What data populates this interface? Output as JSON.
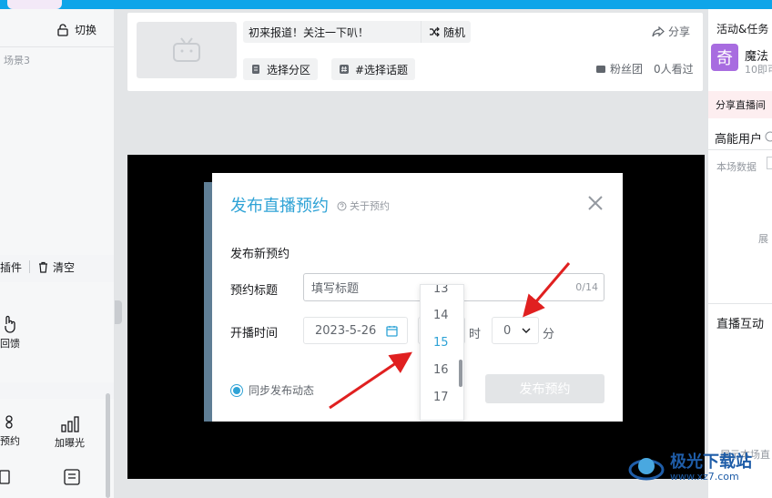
{
  "left_panel": {
    "switch_label": "切换",
    "scene_label": "场景3",
    "plugins_label": "插件",
    "clear_label": "清空",
    "feedback_label": "回馈",
    "reserve_label": "预约",
    "exposure_label": "加曝光"
  },
  "header": {
    "title_value": "初来报道！关注一下叭！",
    "random_label": "随机",
    "share_label": "分享",
    "select_area_label": "选择分区",
    "select_topic_label": "#选择话题",
    "fans_label": "粉丝团",
    "watchers_label": "0人看过"
  },
  "right_panel": {
    "activity_label": "活动&任务",
    "magic_label": "魔法",
    "magic_sub": "10即可",
    "qi_char": "奇",
    "share_live_label": "分享直播间",
    "high_energy_label": "高能用户",
    "this_data_label": "本场数据",
    "expand_label": "展",
    "live_interact_label": "直播互动",
    "show_label": "展示本场直"
  },
  "modal": {
    "title": "发布直播预约",
    "about_label": "关于预约",
    "new_label": "发布新预约",
    "title_field_label": "预约标题",
    "title_placeholder": "填写标题",
    "title_counter": "0/14",
    "time_label": "开播时间",
    "date_value": "2023-5-26",
    "hour_unit": "时",
    "minute_value": "0",
    "minute_unit": "分",
    "hour_options": [
      "13",
      "14",
      "15",
      "16",
      "17"
    ],
    "hour_selected": "15",
    "sync_label": "同步发布动态",
    "publish_label": "发布预约"
  },
  "watermark": {
    "text": "极光下载站",
    "url": "www.xz7.com"
  },
  "colors": {
    "accent": "#2fa3d6",
    "topbar": "#0ea5e9",
    "arrow": "#e02020",
    "qi_purple": "#a86ce0"
  }
}
